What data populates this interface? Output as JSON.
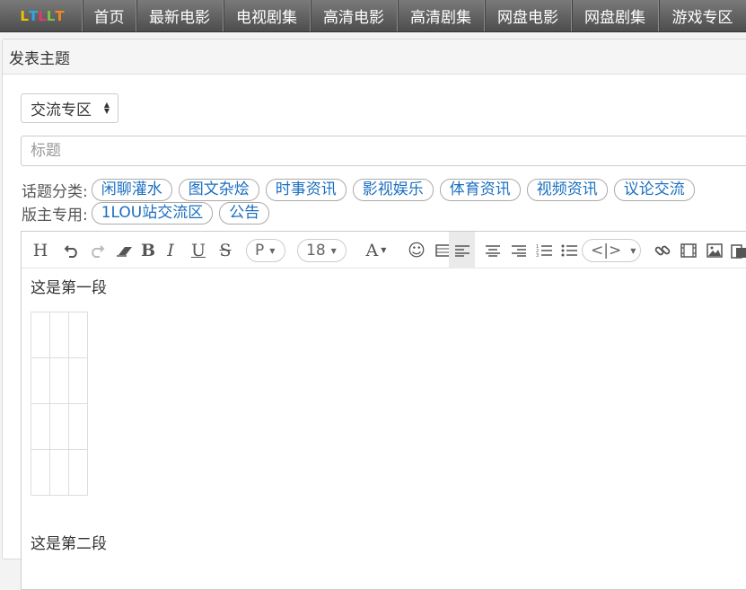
{
  "logo": {
    "letters": [
      "L",
      "T",
      "L",
      "L",
      "T"
    ],
    "colors": [
      "#f2c200",
      "#2fa8e0",
      "#e23b6a",
      "#7fc341",
      "#f28a1c"
    ]
  },
  "nav": {
    "items": [
      "首页",
      "最新电影",
      "电视剧集",
      "高清电影",
      "高清剧集",
      "网盘电影",
      "网盘剧集",
      "游戏专区"
    ]
  },
  "card": {
    "title": "发表主题"
  },
  "form": {
    "forum_select": "交流专区",
    "title_placeholder": "标题",
    "topic_label": "话题分类:",
    "topic_tags": [
      "闲聊灌水",
      "图文杂烩",
      "时事资讯",
      "影视娱乐",
      "体育资讯",
      "视频资讯",
      "议论交流"
    ],
    "mod_label": "版主专用:",
    "mod_tags": [
      "1LOU站交流区",
      "公告"
    ]
  },
  "editor": {
    "toolbar": {
      "heading": "H",
      "paragraph": "P",
      "font_size": "18",
      "font_color": "A",
      "code": "<|>"
    },
    "content": {
      "para1": "这是第一段",
      "para2": "这是第二段"
    }
  }
}
